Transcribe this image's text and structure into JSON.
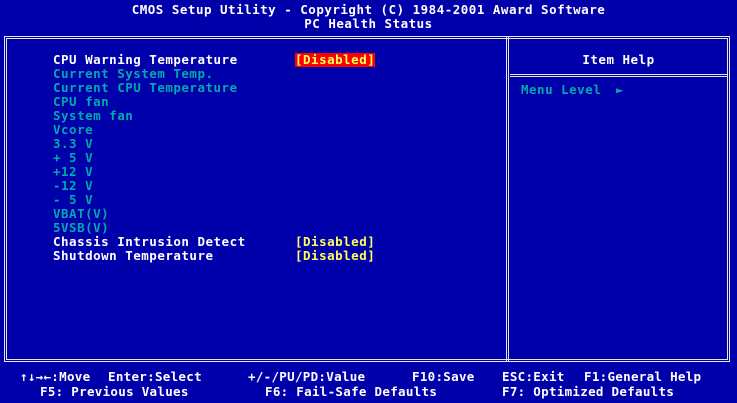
{
  "header": {
    "line1": "CMOS Setup Utility - Copyright (C) 1984-2001 Award Software",
    "line2": "PC Health Status"
  },
  "items": [
    {
      "label": "CPU Warning Temperature",
      "value": "[Disabled]",
      "selected": true
    },
    {
      "label": "Current System Temp."
    },
    {
      "label": "Current CPU Temperature"
    },
    {
      "label": "CPU fan"
    },
    {
      "label": "System fan"
    },
    {
      "label": "Vcore"
    },
    {
      "label": "3.3 V"
    },
    {
      "label": "+ 5 V"
    },
    {
      "label": "+12 V"
    },
    {
      "label": "-12 V"
    },
    {
      "label": "- 5 V"
    },
    {
      "label": "VBAT(V)"
    },
    {
      "label": "5VSB(V)"
    },
    {
      "label": "Chassis Intrusion Detect",
      "value": "[Disabled]"
    },
    {
      "label": "Shutdown Temperature",
      "value": "[Disabled]"
    }
  ],
  "help": {
    "title": "Item Help",
    "menu_level": "Menu Level",
    "menu_arrow": "►"
  },
  "footer": {
    "line1": [
      "↑↓→←:Move",
      "Enter:Select",
      "+/-/PU/PD:Value",
      "F10:Save",
      "ESC:Exit",
      "F1:General Help"
    ],
    "line2": [
      "F5: Previous Values",
      "F6: Fail-Safe Defaults",
      "F7: Optimized Defaults"
    ]
  },
  "colors": {
    "background": "#0000aa",
    "text": "#ffffff",
    "info_text": "#00aaaa",
    "value_text": "#ffff55",
    "selected_bg": "#ff0000"
  }
}
